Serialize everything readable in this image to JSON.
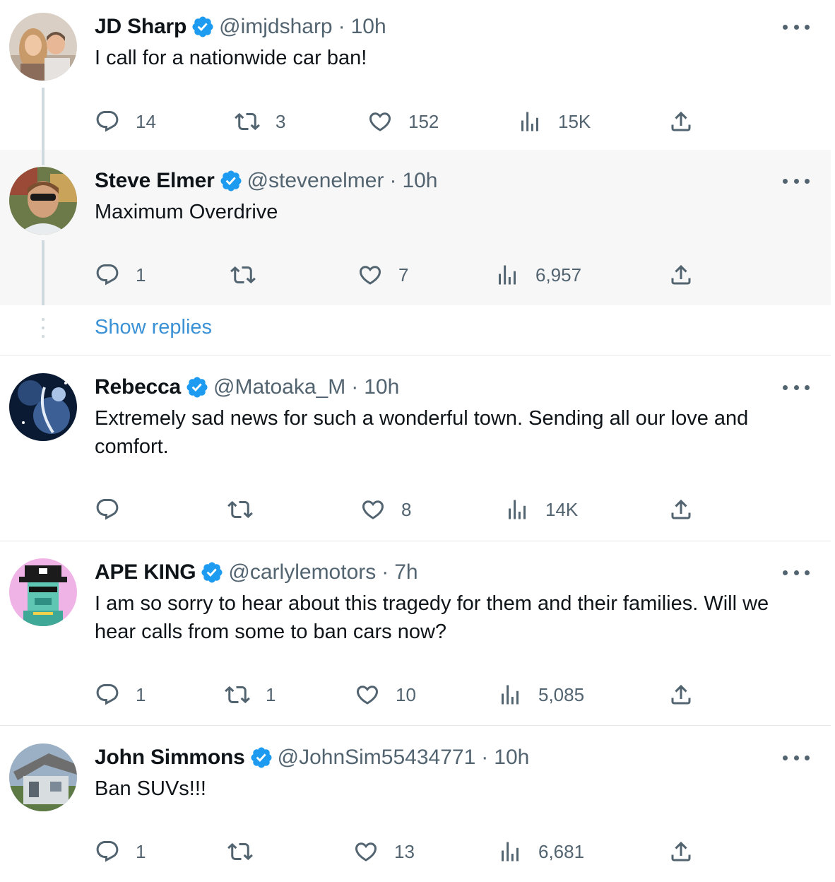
{
  "tweets": [
    {
      "name": "JD Sharp",
      "handle": "@imjdsharp",
      "time": "10h",
      "text": "I call for a nationwide car ban!",
      "replies": "14",
      "retweets": "3",
      "likes": "152",
      "views": "15K"
    },
    {
      "name": "Steve Elmer",
      "handle": "@stevenelmer",
      "time": "10h",
      "text": "Maximum Overdrive",
      "replies": "1",
      "retweets": "",
      "likes": "7",
      "views": "6,957"
    },
    {
      "name": "Rebecca",
      "handle": "@Matoaka_M",
      "time": "10h",
      "text": "Extremely sad news for such a wonderful town. Sending all our love and comfort.",
      "replies": "",
      "retweets": "",
      "likes": "8",
      "views": "14K"
    },
    {
      "name": "APE KING",
      "handle": "@carlylemotors",
      "time": "7h",
      "text": "I am so sorry to hear about this tragedy for them and their families.  Will we hear calls from some to ban cars  now?",
      "replies": "1",
      "retweets": "1",
      "likes": "10",
      "views": "5,085"
    },
    {
      "name": "John Simmons",
      "handle": "@JohnSim55434771",
      "time": "10h",
      "text": "Ban SUVs!!!",
      "replies": "1",
      "retweets": "",
      "likes": "13",
      "views": "6,681"
    }
  ],
  "show_replies": "Show replies",
  "separator": "·",
  "colors": {
    "verified": "#1d9bf0",
    "link": "#3a91d6",
    "secondary_text": "#536471",
    "highlight_bg": "#f7f7f7"
  },
  "icons": [
    "reply-icon",
    "retweet-icon",
    "like-icon",
    "views-icon",
    "share-icon",
    "verified-badge-icon",
    "more-icon"
  ]
}
